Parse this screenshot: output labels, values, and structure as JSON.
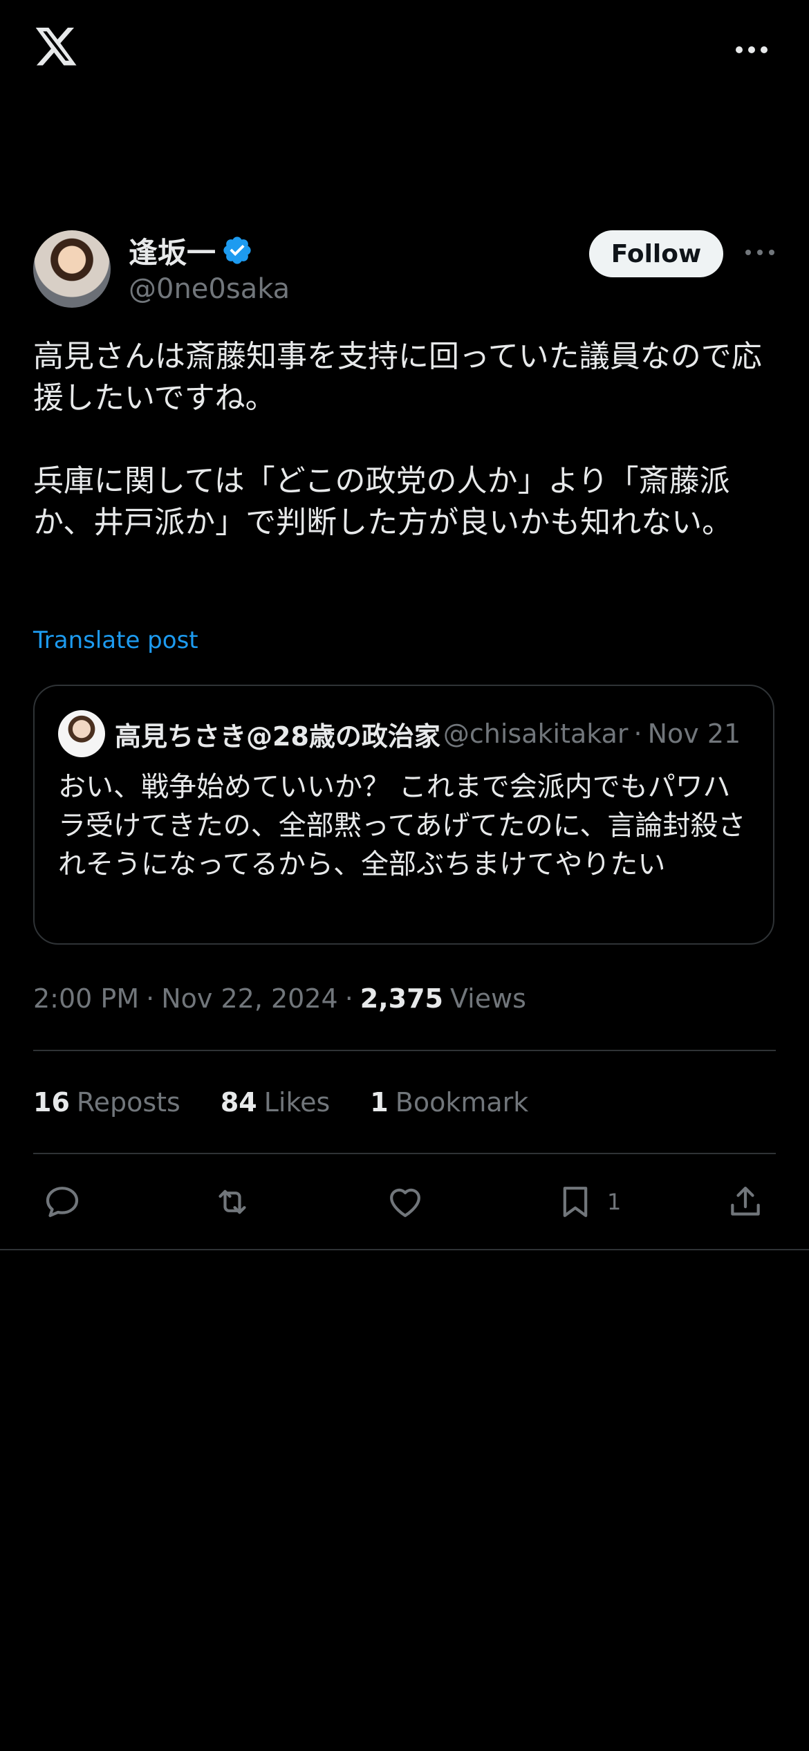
{
  "header": {
    "logo_icon": "x-logo-icon",
    "more_icon": "more-horizontal-icon"
  },
  "author": {
    "display_name": "逢坂一",
    "handle": "@0ne0saka",
    "verified": true,
    "follow_label": "Follow"
  },
  "post": {
    "paragraphs": [
      "高見さんは斎藤知事を支持に回っていた議員なので応援したいですね。",
      "兵庫に関しては「どこの政党の人か」より「斎藤派か、井戸派か」で判断した方が良いかも知れない。"
    ],
    "translate_label": "Translate post"
  },
  "quote": {
    "display_name": "高見ちさき@28歳の政治家",
    "handle": "@chisakitakar",
    "separator": "·",
    "date": "Nov 21",
    "text": "おい、戦争始めていいか？ これまで会派内でもパワハラ受けてきたの、全部黙ってあげてたのに、言論封殺されそうになってるから、全部ぶちまけてやりたい"
  },
  "meta": {
    "time": "2:00 PM",
    "separator": "·",
    "date": "Nov 22, 2024",
    "views_count": "2,375",
    "views_label": "Views"
  },
  "stats": {
    "reposts_count": "16",
    "reposts_label": "Reposts",
    "likes_count": "84",
    "likes_label": "Likes",
    "bookmarks_count": "1",
    "bookmarks_label": "Bookmark"
  },
  "actions": {
    "bookmark_count": "1",
    "icons": [
      "reply-icon",
      "repost-icon",
      "like-icon",
      "bookmark-icon",
      "share-icon"
    ]
  },
  "colors": {
    "background": "#000000",
    "text_primary": "#e7e9ea",
    "text_secondary": "#71767b",
    "link": "#1d9bf0",
    "divider": "#2f3336",
    "follow_bg": "#eff3f4"
  }
}
